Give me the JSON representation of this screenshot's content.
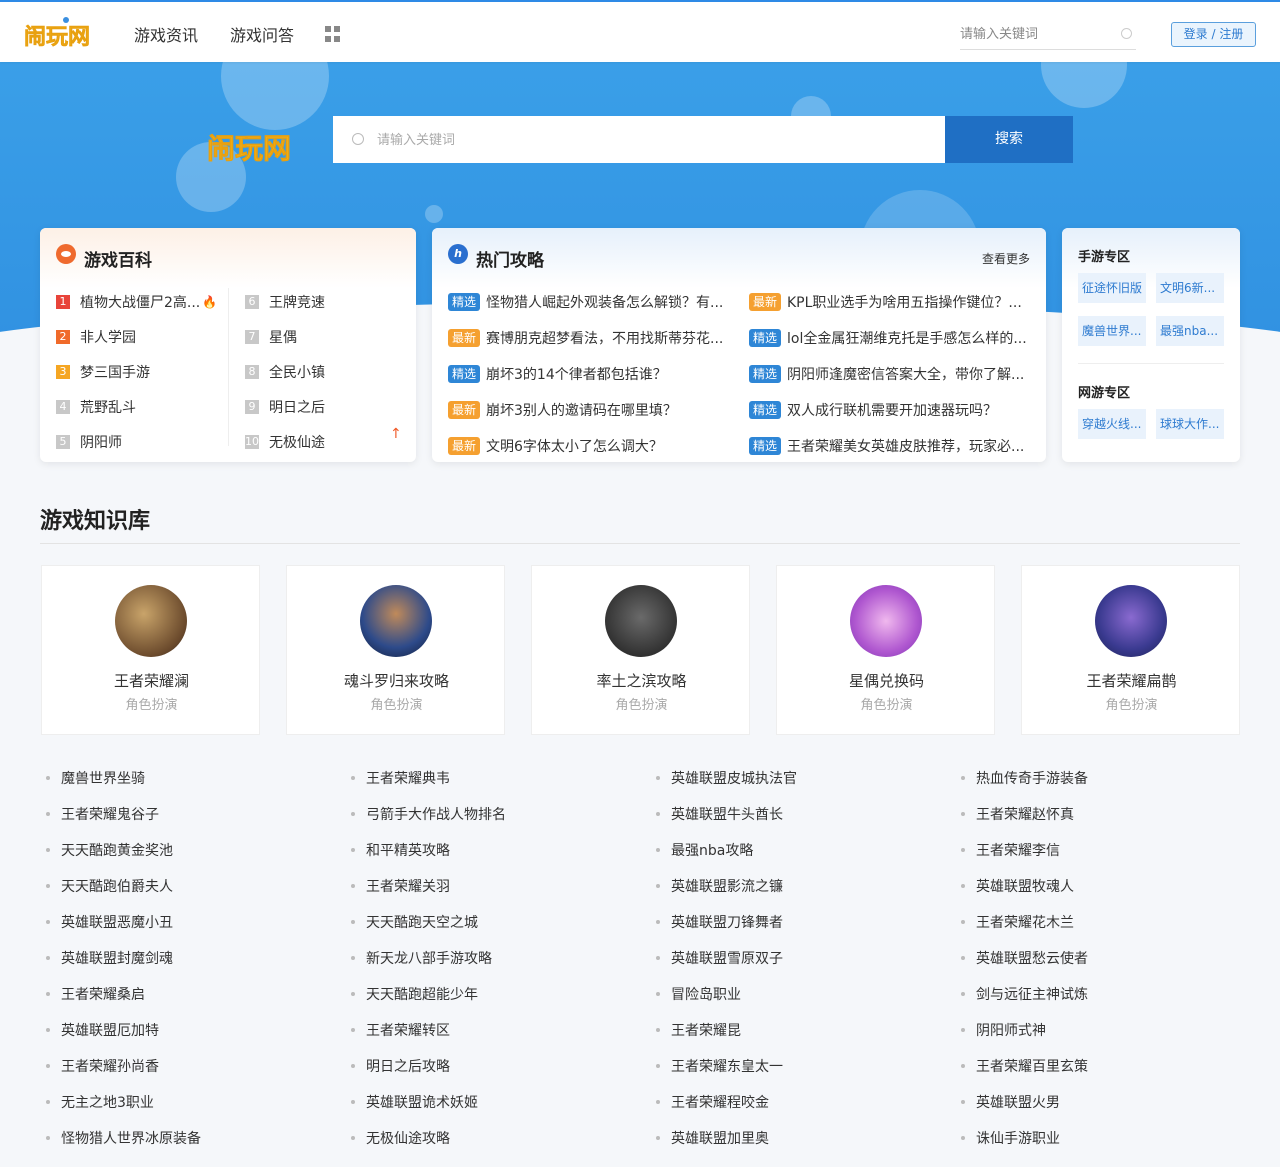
{
  "site": {
    "brand": "闹玩网",
    "colors": {
      "primary": "#2f8fe0",
      "accent": "#f05a28"
    }
  },
  "nav": {
    "items": [
      "游戏资讯",
      "游戏问答"
    ],
    "grid_icon": "grid-icon"
  },
  "top_search": {
    "placeholder": "请输入关键词"
  },
  "login": {
    "label": "登录 / 注册"
  },
  "hero": {
    "search_placeholder": "请输入关键词",
    "search_button": "搜索"
  },
  "baike": {
    "title": "游戏百科",
    "left": [
      {
        "num": "1",
        "name": "植物大战僵尸2高..."
      },
      {
        "num": "2",
        "name": "非人学园"
      },
      {
        "num": "3",
        "name": "梦三国手游"
      },
      {
        "num": "4",
        "name": "荒野乱斗"
      },
      {
        "num": "5",
        "name": "阴阳师"
      }
    ],
    "right": [
      {
        "num": "6",
        "name": "王牌竞速"
      },
      {
        "num": "7",
        "name": "星偶"
      },
      {
        "num": "8",
        "name": "全民小镇"
      },
      {
        "num": "9",
        "name": "明日之后"
      },
      {
        "num": "10",
        "name": "无极仙途"
      }
    ]
  },
  "gonglue": {
    "title": "热门攻略",
    "more": "查看更多",
    "left": [
      {
        "tag": "精选",
        "text": "怪物猎人崛起外观装备怎么解锁？有..."
      },
      {
        "tag": "最新",
        "text": "赛博朋克超梦看法，不用找斯蒂芬花..."
      },
      {
        "tag": "精选",
        "text": "崩坏3的14个律者都包括谁？"
      },
      {
        "tag": "最新",
        "text": "崩坏3别人的邀请码在哪里填？"
      },
      {
        "tag": "最新",
        "text": "文明6字体太小了怎么调大？"
      }
    ],
    "right": [
      {
        "tag": "最新",
        "text": "KPL职业选手为啥用五指操作键位？..."
      },
      {
        "tag": "精选",
        "text": "lol全金属狂潮维克托是手感怎么样的..."
      },
      {
        "tag": "精选",
        "text": "阴阳师逢魔密信答案大全，带你了解..."
      },
      {
        "tag": "精选",
        "text": "双人成行联机需要开加速器玩吗？"
      },
      {
        "tag": "精选",
        "text": "王者荣耀美女英雄皮肤推荐，玩家必..."
      }
    ]
  },
  "zone": {
    "mobile_title": "手游专区",
    "mobile_tags": [
      "征途怀旧版",
      "文明6新...",
      "魔兽世界...",
      "最强nba..."
    ],
    "pc_title": "网游专区",
    "pc_tags": [
      "穿越火线...",
      "球球大作..."
    ]
  },
  "knowledge": {
    "title": "游戏知识库",
    "cards": [
      {
        "name": "王者荣耀澜",
        "sub": "角色扮演"
      },
      {
        "name": "魂斗罗归来攻略",
        "sub": "角色扮演"
      },
      {
        "name": "率土之滨攻略",
        "sub": "角色扮演"
      },
      {
        "name": "星偶兑换码",
        "sub": "角色扮演"
      },
      {
        "name": "王者荣耀扁鹊",
        "sub": "角色扮演"
      }
    ],
    "links": [
      [
        "魔兽世界坐骑",
        "王者荣耀鬼谷子",
        "天天酷跑黄金奖池",
        "天天酷跑伯爵夫人",
        "英雄联盟恶魔小丑",
        "英雄联盟封魔剑魂",
        "王者荣耀桑启",
        "英雄联盟厄加特",
        "王者荣耀孙尚香",
        "无主之地3职业",
        "怪物猎人世界冰原装备"
      ],
      [
        "王者荣耀典韦",
        "弓箭手大作战人物排名",
        "和平精英攻略",
        "王者荣耀关羽",
        "天天酷跑天空之城",
        "新天龙八部手游攻略",
        "天天酷跑超能少年",
        "王者荣耀转区",
        "明日之后攻略",
        "英雄联盟诡术妖姬",
        "无极仙途攻略"
      ],
      [
        "英雄联盟皮城执法官",
        "英雄联盟牛头酋长",
        "最强nba攻略",
        "英雄联盟影流之镰",
        "英雄联盟刀锋舞者",
        "英雄联盟雪原双子",
        "冒险岛职业",
        "王者荣耀昆",
        "王者荣耀东皇太一",
        "王者荣耀程咬金",
        "英雄联盟加里奥"
      ],
      [
        "热血传奇手游装备",
        "王者荣耀赵怀真",
        "王者荣耀李信",
        "英雄联盟牧魂人",
        "王者荣耀花木兰",
        "英雄联盟愁云使者",
        "剑与远征主神试炼",
        "阴阳师式神",
        "王者荣耀百里玄策",
        "英雄联盟火男",
        "诛仙手游职业"
      ]
    ]
  }
}
